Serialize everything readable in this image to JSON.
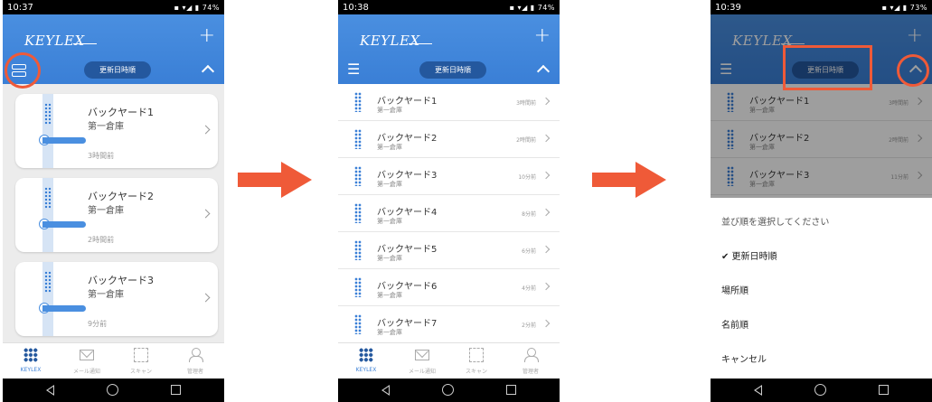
{
  "colors": {
    "accent": "#3a7fd6",
    "annotation": "#ef5a38",
    "pill": "#24589e"
  },
  "icons": [
    "view-toggle-icon",
    "list-icon",
    "plus-icon",
    "chevron-up-icon",
    "chevron-right-icon",
    "keylex-grid-icon",
    "mail-icon",
    "qr-scan-icon",
    "user-icon",
    "back-icon",
    "home-icon",
    "recents-icon"
  ],
  "screens": [
    {
      "status": {
        "time": "10:37",
        "battery": "74%"
      },
      "header": {
        "logo": "KEYLEX",
        "sort_label": "更新日時順"
      },
      "cards": [
        {
          "name": "バックヤード1",
          "place": "第一倉庫",
          "time": "3時間前"
        },
        {
          "name": "バックヤード2",
          "place": "第一倉庫",
          "time": "2時間前"
        },
        {
          "name": "バックヤード3",
          "place": "第一倉庫",
          "time": "9分前"
        }
      ]
    },
    {
      "status": {
        "time": "10:38",
        "battery": "74%"
      },
      "header": {
        "logo": "KEYLEX",
        "sort_label": "更新日時順"
      },
      "rows": [
        {
          "name": "バックヤード1",
          "place": "第一倉庫",
          "time": "3時間前"
        },
        {
          "name": "バックヤード2",
          "place": "第一倉庫",
          "time": "2時間前"
        },
        {
          "name": "バックヤード3",
          "place": "第一倉庫",
          "time": "10分前"
        },
        {
          "name": "バックヤード4",
          "place": "第一倉庫",
          "time": "8分前"
        },
        {
          "name": "バックヤード5",
          "place": "第一倉庫",
          "time": "6分前"
        },
        {
          "name": "バックヤード6",
          "place": "第一倉庫",
          "time": "4分前"
        },
        {
          "name": "バックヤード7",
          "place": "第一倉庫",
          "time": "2分前"
        }
      ]
    },
    {
      "status": {
        "time": "10:39",
        "battery": "73%"
      },
      "header": {
        "logo": "KEYLEX",
        "sort_label": "更新日時順"
      },
      "rows": [
        {
          "name": "バックヤード1",
          "place": "第一倉庫",
          "time": "3時間前"
        },
        {
          "name": "バックヤード2",
          "place": "第一倉庫",
          "time": "2時間前"
        },
        {
          "name": "バックヤード3",
          "place": "第一倉庫",
          "time": "11分前"
        }
      ],
      "sheet": {
        "prompt": "並び順を選択してください",
        "options": [
          "✔ 更新日時順",
          "場所順",
          "名前順",
          "キャンセル"
        ]
      }
    }
  ],
  "tabbar": [
    "KEYLEX",
    "メール通知",
    "スキャン",
    "管理者"
  ]
}
